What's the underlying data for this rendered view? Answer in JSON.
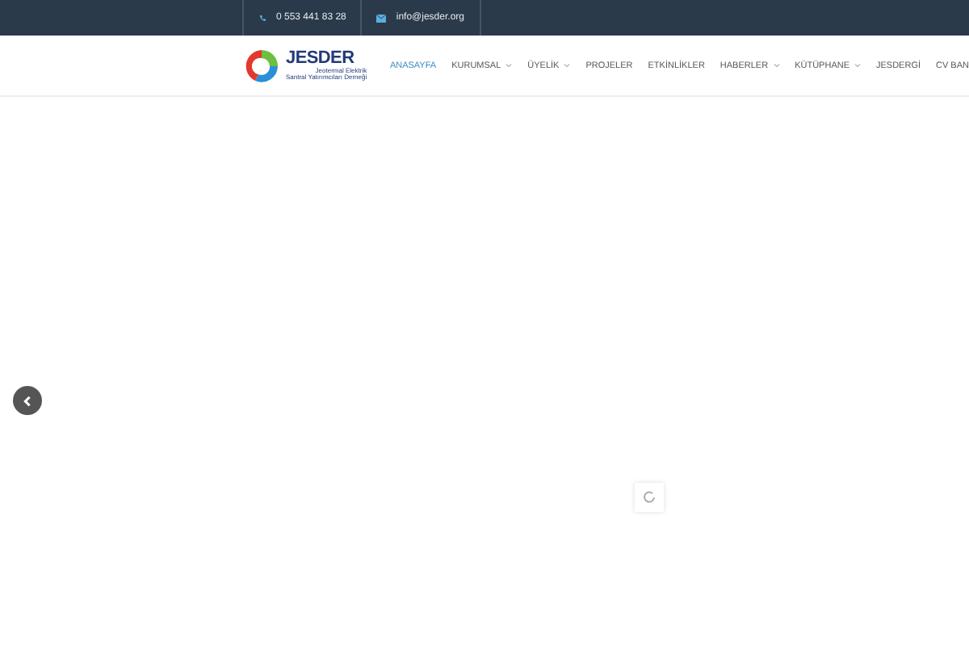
{
  "top_bar": {
    "phone": "0 553 441 83 28",
    "email": "info@jesder.org"
  },
  "logo": {
    "name": "JESDER",
    "subtitle_lines": [
      "Jeotermal Elektrik",
      "Santral Yatırımcıları Derneği"
    ]
  },
  "nav": [
    {
      "label": "ANASAYFA",
      "selected": true,
      "dropdown": false
    },
    {
      "label": "KURUMSAL",
      "selected": false,
      "dropdown": true
    },
    {
      "label": "ÜYELİK",
      "selected": false,
      "dropdown": true
    },
    {
      "label": "PROJELER",
      "selected": false,
      "dropdown": false
    },
    {
      "label": "ETKİNLİKLER",
      "selected": false,
      "dropdown": false
    },
    {
      "label": "HABERLER",
      "selected": false,
      "dropdown": true
    },
    {
      "label": "KÜTÜPHANE",
      "selected": false,
      "dropdown": true
    },
    {
      "label": "JESDERGİ",
      "selected": false,
      "dropdown": false
    },
    {
      "label": "CV BAN",
      "selected": false,
      "dropdown": false
    }
  ]
}
